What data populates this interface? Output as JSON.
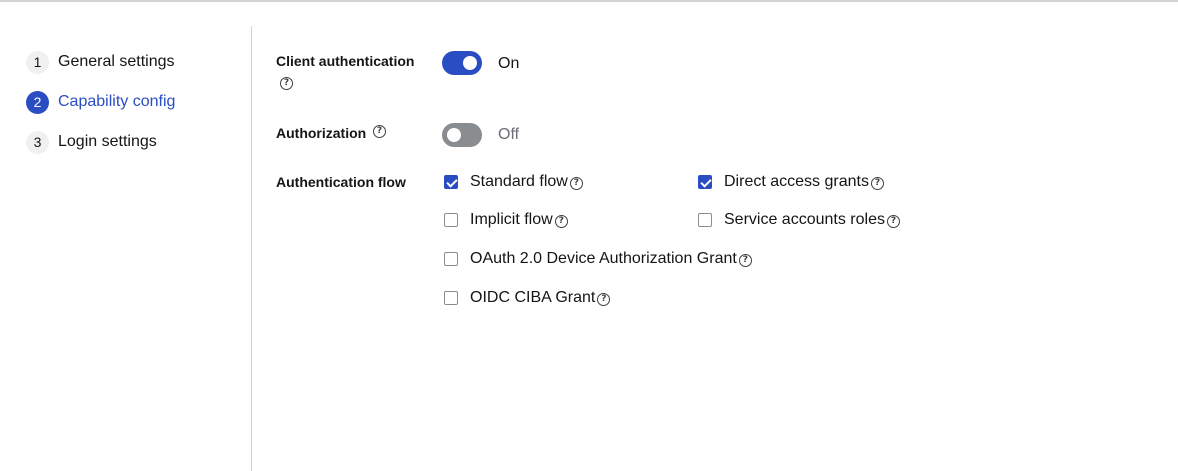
{
  "wizard": {
    "steps": [
      {
        "number": "1",
        "label": "General settings"
      },
      {
        "number": "2",
        "label": "Capability config"
      },
      {
        "number": "3",
        "label": "Login settings"
      }
    ],
    "active_step": "2"
  },
  "form": {
    "client_authentication": {
      "label": "Client authentication",
      "state": "On",
      "enabled": true
    },
    "authorization": {
      "label": "Authorization",
      "state": "Off",
      "enabled": false
    },
    "authentication_flow": {
      "label": "Authentication flow",
      "options": [
        {
          "label": "Standard flow",
          "checked": true
        },
        {
          "label": "Direct access grants",
          "checked": true
        },
        {
          "label": "Implicit flow",
          "checked": false
        },
        {
          "label": "Service accounts roles",
          "checked": false
        },
        {
          "label": "OAuth 2.0 Device Authorization Grant",
          "checked": false
        },
        {
          "label": "OIDC CIBA Grant",
          "checked": false
        }
      ]
    }
  },
  "icons": {
    "help": "question-circle-icon",
    "check": "checkmark-icon"
  },
  "colors": {
    "accent": "#2b4dc3",
    "switch_off": "#8a8d90",
    "text": "#151515",
    "muted": "#6a6e73",
    "divider": "#d2d2d2"
  }
}
